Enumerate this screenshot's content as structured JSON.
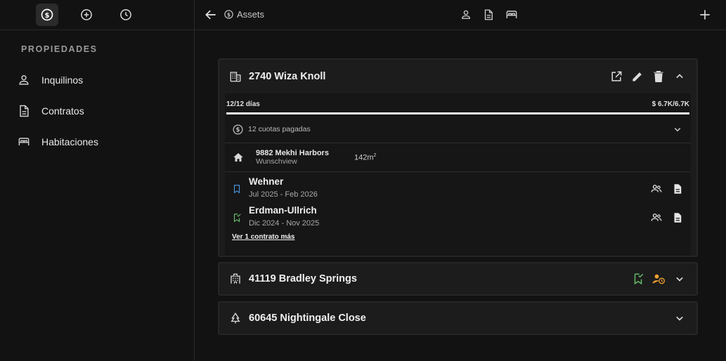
{
  "sidebar": {
    "section_title": "PROPIEDADES",
    "top_icons": [
      "dollar-icon",
      "plus-circle-icon",
      "clock-icon"
    ],
    "items": [
      {
        "label": "Inquilinos",
        "icon": "person-icon"
      },
      {
        "label": "Contratos",
        "icon": "document-icon"
      },
      {
        "label": "Habitaciones",
        "icon": "bed-icon"
      }
    ]
  },
  "topbar": {
    "breadcrumb": "Assets",
    "center_icons": [
      "person-icon",
      "document-icon",
      "bed-icon"
    ]
  },
  "colors": {
    "background": "#121212",
    "card": "#1c1c1c",
    "accent_blue": "#4a90d9",
    "accent_green": "#66bb6a",
    "accent_orange": "#f0a030"
  },
  "properties": [
    {
      "name": "2740 Wiza Knoll",
      "icon": "building-icon",
      "expanded": true,
      "progress_left": "12/12 días",
      "progress_right": "$ 6.7K/6.7K",
      "progress_fraction": 1.0,
      "quota_label": "12 cuotas pagadas",
      "address_street": "9882 Mekhi Harbors",
      "address_city": "Wunschview",
      "area": "142m",
      "area_sup": "2",
      "tenants": [
        {
          "name": "Wehner",
          "dates": "Jul 2025 - Feb 2026",
          "status": "active"
        },
        {
          "name": "Erdman-Ullrich",
          "dates": "Dic 2024 - Nov 2025",
          "status": "verified"
        }
      ],
      "more_link": "Ver 1 contrato más"
    },
    {
      "name": "41119 Bradley Springs",
      "icon": "apartment-icon",
      "expanded": false
    },
    {
      "name": "60645 Nightingale Close",
      "icon": "tree-icon",
      "expanded": false
    }
  ]
}
